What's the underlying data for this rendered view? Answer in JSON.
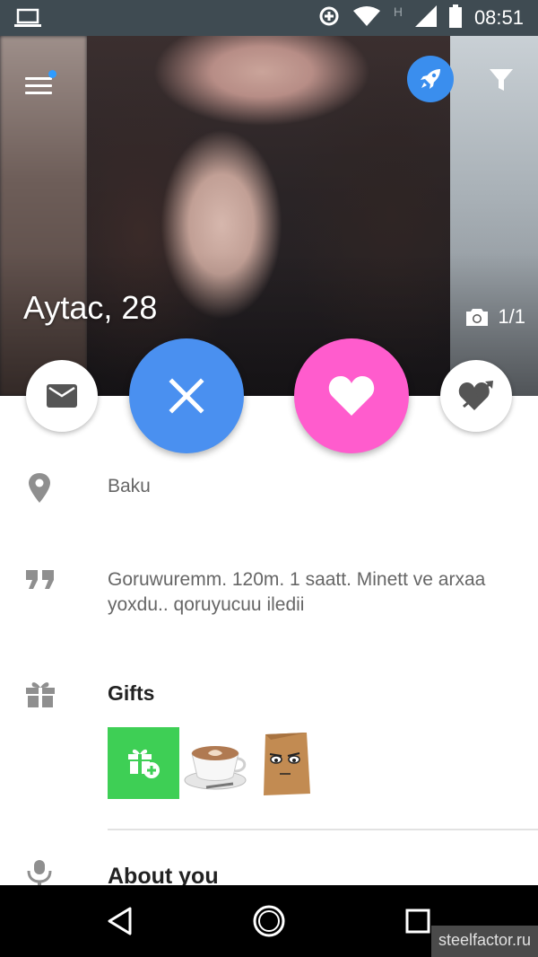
{
  "status_bar": {
    "time": "08:51",
    "network_label": "H"
  },
  "profile": {
    "name_age": "Aytac, 28",
    "photo_counter": "1/1",
    "location": "Baku",
    "quote": "Goruwuremm. 120m. 1 saatt. Minett ve arxaa yoxdu.. qoruyucuu iledii"
  },
  "gifts": {
    "title": "Gifts",
    "items": [
      {
        "icon": "add-gift-icon",
        "color": "#3ecf55"
      },
      {
        "icon": "coffee-cup-icon"
      },
      {
        "icon": "paper-bag-face-icon"
      }
    ]
  },
  "about": {
    "title": "About you"
  },
  "colors": {
    "boost": "#3a8eee",
    "skip": "#4a90f0",
    "like": "#ff5ccd",
    "menu_dot": "#2f9cff"
  },
  "watermark": "steelfactor.ru"
}
